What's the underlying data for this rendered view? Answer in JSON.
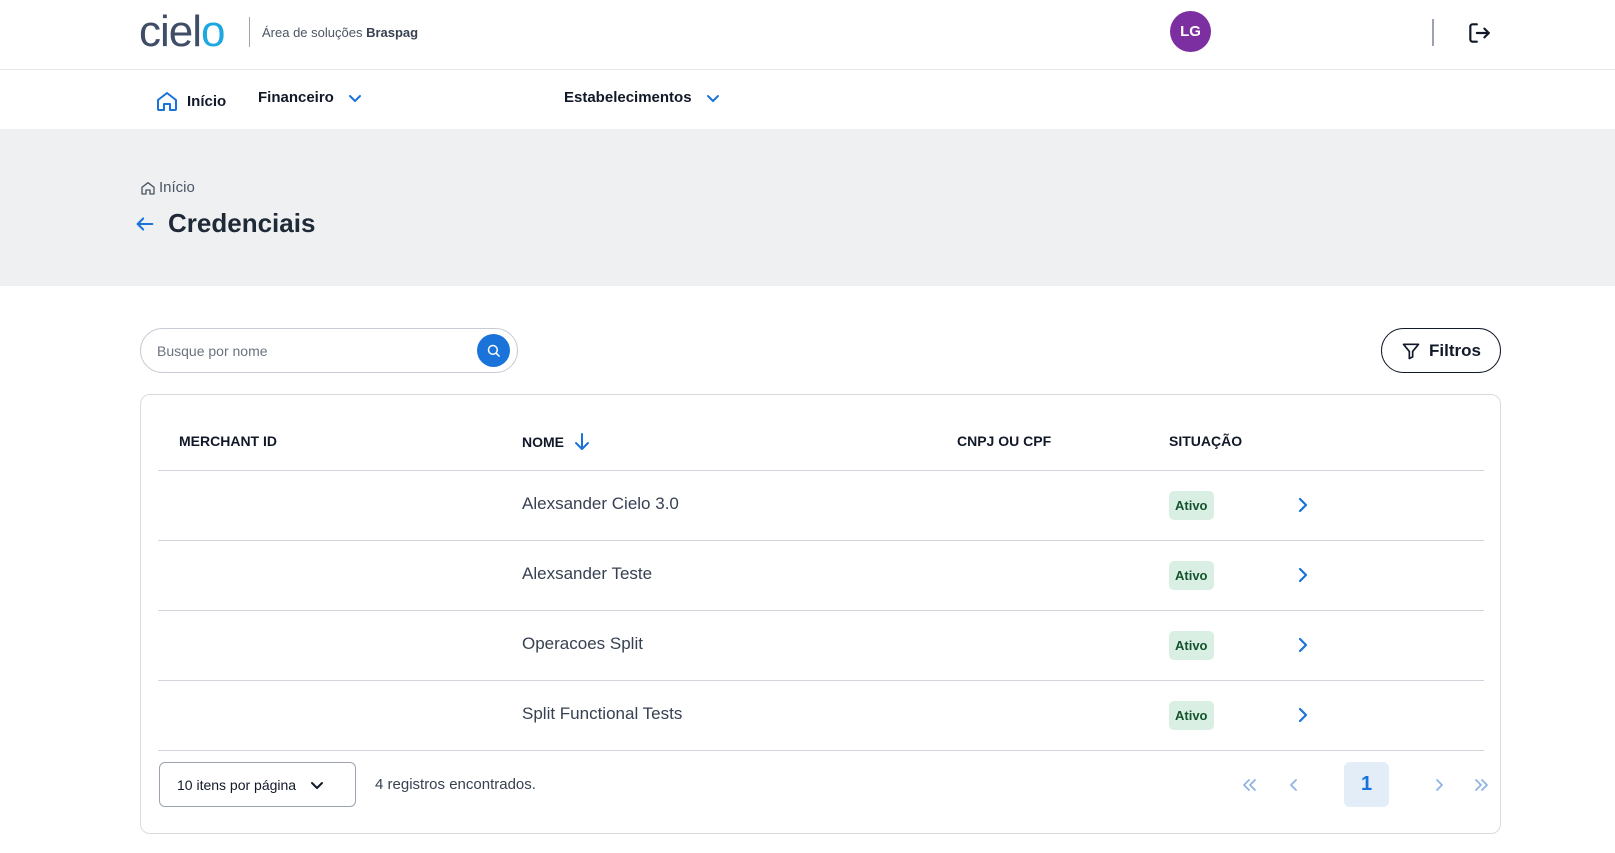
{
  "header": {
    "logo_text_a": "ciel",
    "logo_text_b": "o",
    "subtitle_prefix": "Área de soluções",
    "subtitle_brand": "Braspag",
    "avatar_initials": "LG",
    "brand_color": "#1ea7e1",
    "avatar_color": "#7b2fa0"
  },
  "nav": {
    "items": [
      {
        "label": "Início",
        "icon": "home-icon"
      },
      {
        "label": "Financeiro",
        "icon": "chevron-down-icon"
      },
      {
        "label": "Estabelecimentos",
        "icon": "chevron-down-icon"
      }
    ]
  },
  "banner": {
    "breadcrumb": "Início",
    "title": "Credenciais"
  },
  "search": {
    "placeholder": "Busque por nome"
  },
  "filters": {
    "label": "Filtros"
  },
  "table": {
    "columns": [
      "MERCHANT ID",
      "NOME",
      "CNPJ OU CPF",
      "SITUAÇÃO"
    ],
    "sort_column": "NOME",
    "rows": [
      {
        "merchant_id": "",
        "name": "Alexsander Cielo 3.0",
        "cnpj": "",
        "status": "Ativo"
      },
      {
        "merchant_id": "",
        "name": "Alexsander Teste",
        "cnpj": "",
        "status": "Ativo"
      },
      {
        "merchant_id": "",
        "name": "Operacoes Split",
        "cnpj": "",
        "status": "Ativo"
      },
      {
        "merchant_id": "",
        "name": "Split Functional Tests",
        "cnpj": "",
        "status": "Ativo"
      }
    ]
  },
  "pagination": {
    "per_page_label": "10 itens por página",
    "records_found": "4 registros encontrados.",
    "current_page": "1"
  },
  "accent_color": "#1a73d9"
}
